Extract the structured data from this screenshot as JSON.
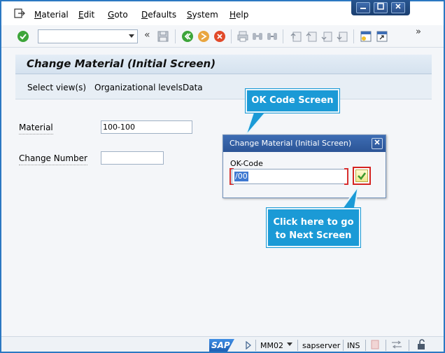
{
  "menubar": {
    "items": [
      "Material",
      "Edit",
      "Goto",
      "Defaults",
      "System",
      "Help"
    ],
    "underline": [
      "M",
      "E",
      "G",
      "D",
      "S",
      "H"
    ]
  },
  "toolbar": {
    "more": "»",
    "collapse": "«"
  },
  "title": "Change Material (Initial Screen)",
  "application_toolbar": [
    "Select view(s)",
    "Organizational levels",
    "Data"
  ],
  "form": {
    "material_label": "Material",
    "material_value": "100-100",
    "change_number_label": "Change Number",
    "change_number_value": ""
  },
  "dialog": {
    "title": "Change Material (Initial Screen)",
    "okcode_label": "OK-Code",
    "okcode_value": "/00"
  },
  "callouts": {
    "top": "OK Code Screen",
    "bottom_line1": "Click here to go",
    "bottom_line2": "to Next Screen"
  },
  "statusbar": {
    "logo": "SAP",
    "transaction": "MM02",
    "server": "sapserver",
    "mode": "INS"
  },
  "colors": {
    "callout": "#1b9ad6",
    "highlight": "#d52421",
    "dialog_title": "#2c5596"
  }
}
